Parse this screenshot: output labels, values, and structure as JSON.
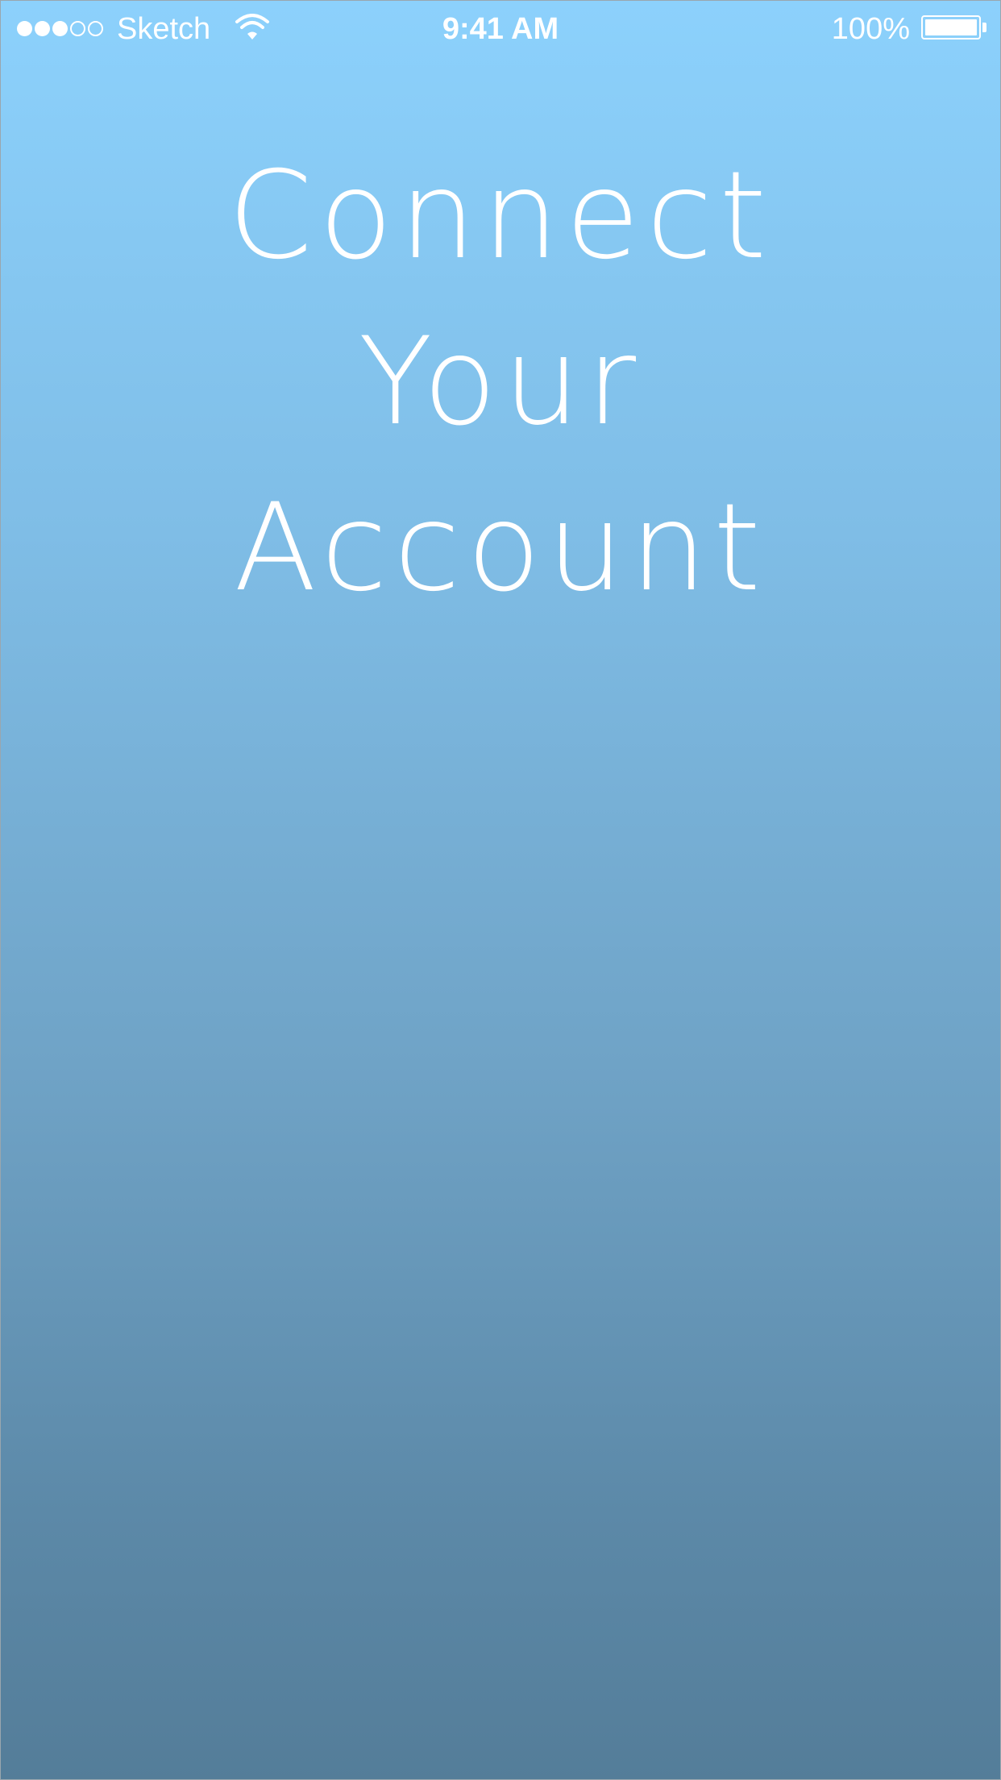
{
  "status_bar": {
    "signal_bars_filled": 3,
    "signal_bars_total": 5,
    "carrier": "Sketch",
    "wifi_icon": "wifi-icon",
    "time": "9:41 AM",
    "battery_percent": "100%",
    "battery_level": 1.0,
    "battery_icon": "battery-icon"
  },
  "main": {
    "title_lines": [
      "Connect",
      "Your",
      "Account"
    ]
  },
  "colors": {
    "gradient_top": "#8cd1fc",
    "gradient_bottom": "#547d99",
    "text": "#ffffff"
  }
}
